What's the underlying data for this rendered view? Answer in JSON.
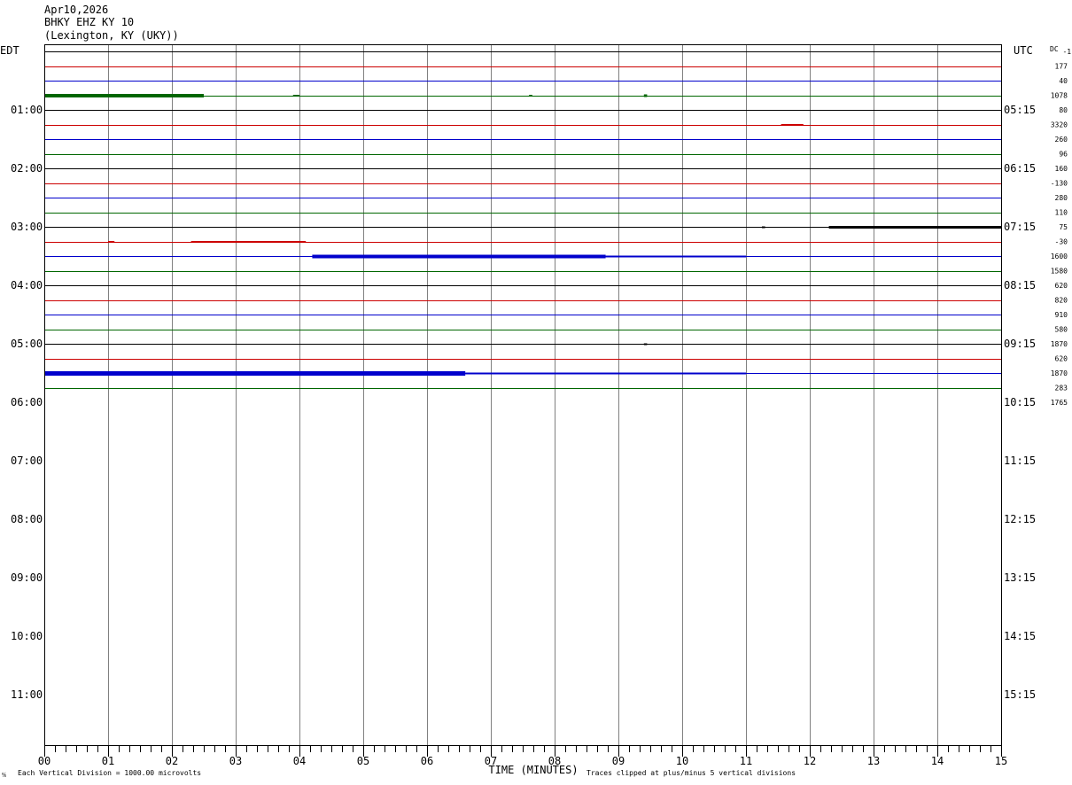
{
  "header": {
    "date": "Apr10,2026",
    "station": "BHKY EHZ KY 10",
    "location": "(Lexington, KY (UKY))"
  },
  "labels": {
    "left_timezone": "EDT",
    "right_timezone": "UTC",
    "dc_label": "DC",
    "dc_subscript": "-1",
    "xlabel": "TIME (MINUTES)",
    "scale_note": "Each Vertical Division = 1000.00 microvolts",
    "clip_note": "Traces clipped at plus/minus 5 vertical divisions",
    "corner_mark": "⅍"
  },
  "colors": {
    "trace_cycle": [
      "#000000",
      "#cc0000",
      "#0000cc",
      "#006600"
    ],
    "frame": "#000000",
    "minute_grid": "#808080"
  },
  "chart_data": {
    "type": "line",
    "title": "",
    "xlabel": "TIME (MINUTES)",
    "ylabel": "",
    "xlim": [
      0,
      15
    ],
    "x_ticks": [
      "00",
      "01",
      "02",
      "03",
      "04",
      "05",
      "06",
      "07",
      "08",
      "09",
      "10",
      "11",
      "12",
      "13",
      "14",
      "15"
    ],
    "minor_ticks_per_minute": 6,
    "grid": true,
    "trace_interval_minutes": 15,
    "hour_labels_left": [
      "01:00",
      "02:00",
      "03:00",
      "04:00",
      "05:00",
      "06:00",
      "07:00",
      "08:00",
      "09:00",
      "10:00",
      "11:00"
    ],
    "hour_labels_right": [
      "05:15",
      "06:15",
      "07:15",
      "08:15",
      "09:15",
      "10:15",
      "11:15",
      "12:15",
      "13:15",
      "14:15",
      "15:15"
    ],
    "traces_recorded": 24,
    "dc_offsets": [
      "177",
      "40",
      "1078",
      "80",
      "3320",
      "260",
      "96",
      "160",
      "-130",
      "280",
      "110",
      "75",
      "-30",
      "1600",
      "1580",
      "620",
      "820",
      "910",
      "580",
      "1870",
      "620",
      "1870",
      "283",
      "1765"
    ],
    "activity": [
      {
        "trace": 3,
        "segments": [
          [
            0.0,
            2.5,
            2.0
          ],
          [
            3.9,
            4.0,
            1.0
          ],
          [
            7.6,
            7.65,
            1.0
          ],
          [
            9.4,
            9.45,
            1.5
          ]
        ]
      },
      {
        "trace": 5,
        "segments": [
          [
            11.55,
            11.9,
            1.0
          ]
        ]
      },
      {
        "trace": 12,
        "segments": [
          [
            11.25,
            11.3,
            1.0
          ],
          [
            12.3,
            15.0,
            1.5
          ]
        ]
      },
      {
        "trace": 13,
        "segments": [
          [
            1.0,
            1.1,
            1.0
          ],
          [
            2.3,
            4.1,
            1.0
          ]
        ]
      },
      {
        "trace": 14,
        "segments": [
          [
            4.2,
            8.8,
            2.0
          ],
          [
            8.8,
            11.0,
            1.0
          ]
        ]
      },
      {
        "trace": 20,
        "segments": [
          [
            9.4,
            9.45,
            1.0
          ]
        ]
      },
      {
        "trace": 22,
        "segments": [
          [
            0.0,
            6.6,
            2.5
          ],
          [
            6.6,
            11.0,
            1.0
          ]
        ]
      }
    ]
  }
}
